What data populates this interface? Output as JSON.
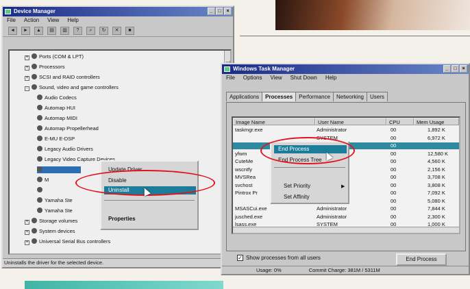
{
  "device_manager": {
    "title": "Device Manager",
    "menu": [
      "File",
      "Action",
      "View",
      "Help"
    ],
    "tree": [
      {
        "label": "Ports (COM & LPT)",
        "icon": "port-icon",
        "expander": "+"
      },
      {
        "label": "Processors",
        "icon": "processor-icon",
        "expander": "+"
      },
      {
        "label": "SCSI and RAID controllers",
        "icon": "scsi-icon",
        "expander": "+"
      },
      {
        "label": "Sound, video and game controllers",
        "icon": "sound-icon",
        "expander": "-"
      },
      {
        "label": "Audio Codecs",
        "icon": "device-icon"
      },
      {
        "label": "Automap HUI",
        "icon": "device-icon"
      },
      {
        "label": "Automap MIDI",
        "icon": "device-icon"
      },
      {
        "label": "Automap Propellerhead",
        "icon": "device-icon"
      },
      {
        "label": "E-MU E-DSP",
        "icon": "device-icon"
      },
      {
        "label": "Legacy Audio Drivers",
        "icon": "device-icon"
      },
      {
        "label": "Legacy Video Capture Devices",
        "icon": "device-icon"
      },
      {
        "label": "",
        "icon": "device-icon",
        "selected": true
      },
      {
        "label": "M",
        "icon": "device-icon"
      },
      {
        "label": "",
        "icon": "device-icon"
      },
      {
        "label": "Yamaha Ste",
        "icon": "device-icon"
      },
      {
        "label": "Yamaha Ste",
        "icon": "device-icon"
      },
      {
        "label": "Storage volumes",
        "icon": "storage-icon",
        "expander": "+"
      },
      {
        "label": "System devices",
        "icon": "system-icon",
        "expander": "+"
      },
      {
        "label": "Universal Serial Bus controllers",
        "icon": "usb-icon",
        "expander": "+"
      }
    ],
    "context_menu": {
      "items": [
        "Update Driver",
        "Disable",
        "Uninstall",
        "Properties"
      ],
      "highlighted": "Uninstall"
    },
    "status": "Uninstalls the driver for the selected device."
  },
  "task_manager": {
    "title": "Windows Task Manager",
    "menu": [
      "File",
      "Options",
      "View",
      "Shut Down",
      "Help"
    ],
    "tabs": [
      "Applications",
      "Processes",
      "Performance",
      "Networking",
      "Users"
    ],
    "active_tab": "Processes",
    "columns": [
      "Image Name",
      "User Name",
      "CPU",
      "Mem Usage"
    ],
    "rows": [
      {
        "name": "taskmgr.exe",
        "user": "Administrator",
        "cpu": "00",
        "mem": "1,892 K"
      },
      {
        "name": "",
        "user": "SYSTEM",
        "cpu": "00",
        "mem": "6,972 K"
      },
      {
        "name": "",
        "user": "",
        "cpu": "00",
        "mem": "",
        "selected": true
      },
      {
        "name": "yfwm",
        "user": "",
        "cpu": "00",
        "mem": "12,580 K"
      },
      {
        "name": "CuteMe",
        "user": "",
        "cpu": "00",
        "mem": "4,560 K"
      },
      {
        "name": "wscntfy",
        "user": "",
        "cpu": "00",
        "mem": "2,156 K"
      },
      {
        "name": "MVSRea",
        "user": "",
        "cpu": "00",
        "mem": "3,708 K"
      },
      {
        "name": "svchost",
        "user": "",
        "cpu": "00",
        "mem": "3,808 K"
      },
      {
        "name": "Pintrox Pr",
        "user": "",
        "cpu": "00",
        "mem": "7,092 K"
      },
      {
        "name": "",
        "user": "SYSTEM",
        "cpu": "00",
        "mem": "5,080 K"
      },
      {
        "name": "MSASCui.exe",
        "user": "Administrator",
        "cpu": "00",
        "mem": "7,844 K"
      },
      {
        "name": "jusched.exe",
        "user": "Administrator",
        "cpu": "00",
        "mem": "2,300 K"
      },
      {
        "name": "lsass.exe",
        "user": "SYSTEM",
        "cpu": "00",
        "mem": "1,000 K"
      }
    ],
    "context_menu": {
      "items": [
        "End Process",
        "End Process Tree",
        "Set Priority",
        "Set Affinity"
      ],
      "highlighted": "End Process"
    },
    "show_all_label": "Show processes from all users",
    "show_all_checked": true,
    "end_process_label": "End Process",
    "status": {
      "cpu": "Usage: 0%",
      "commit": "Commit Charge: 381M / 5311M"
    }
  },
  "colors": {
    "highlight_ring": "#e2131b",
    "title_bar": "#1b2b86",
    "selection": "#2f8aa0"
  }
}
